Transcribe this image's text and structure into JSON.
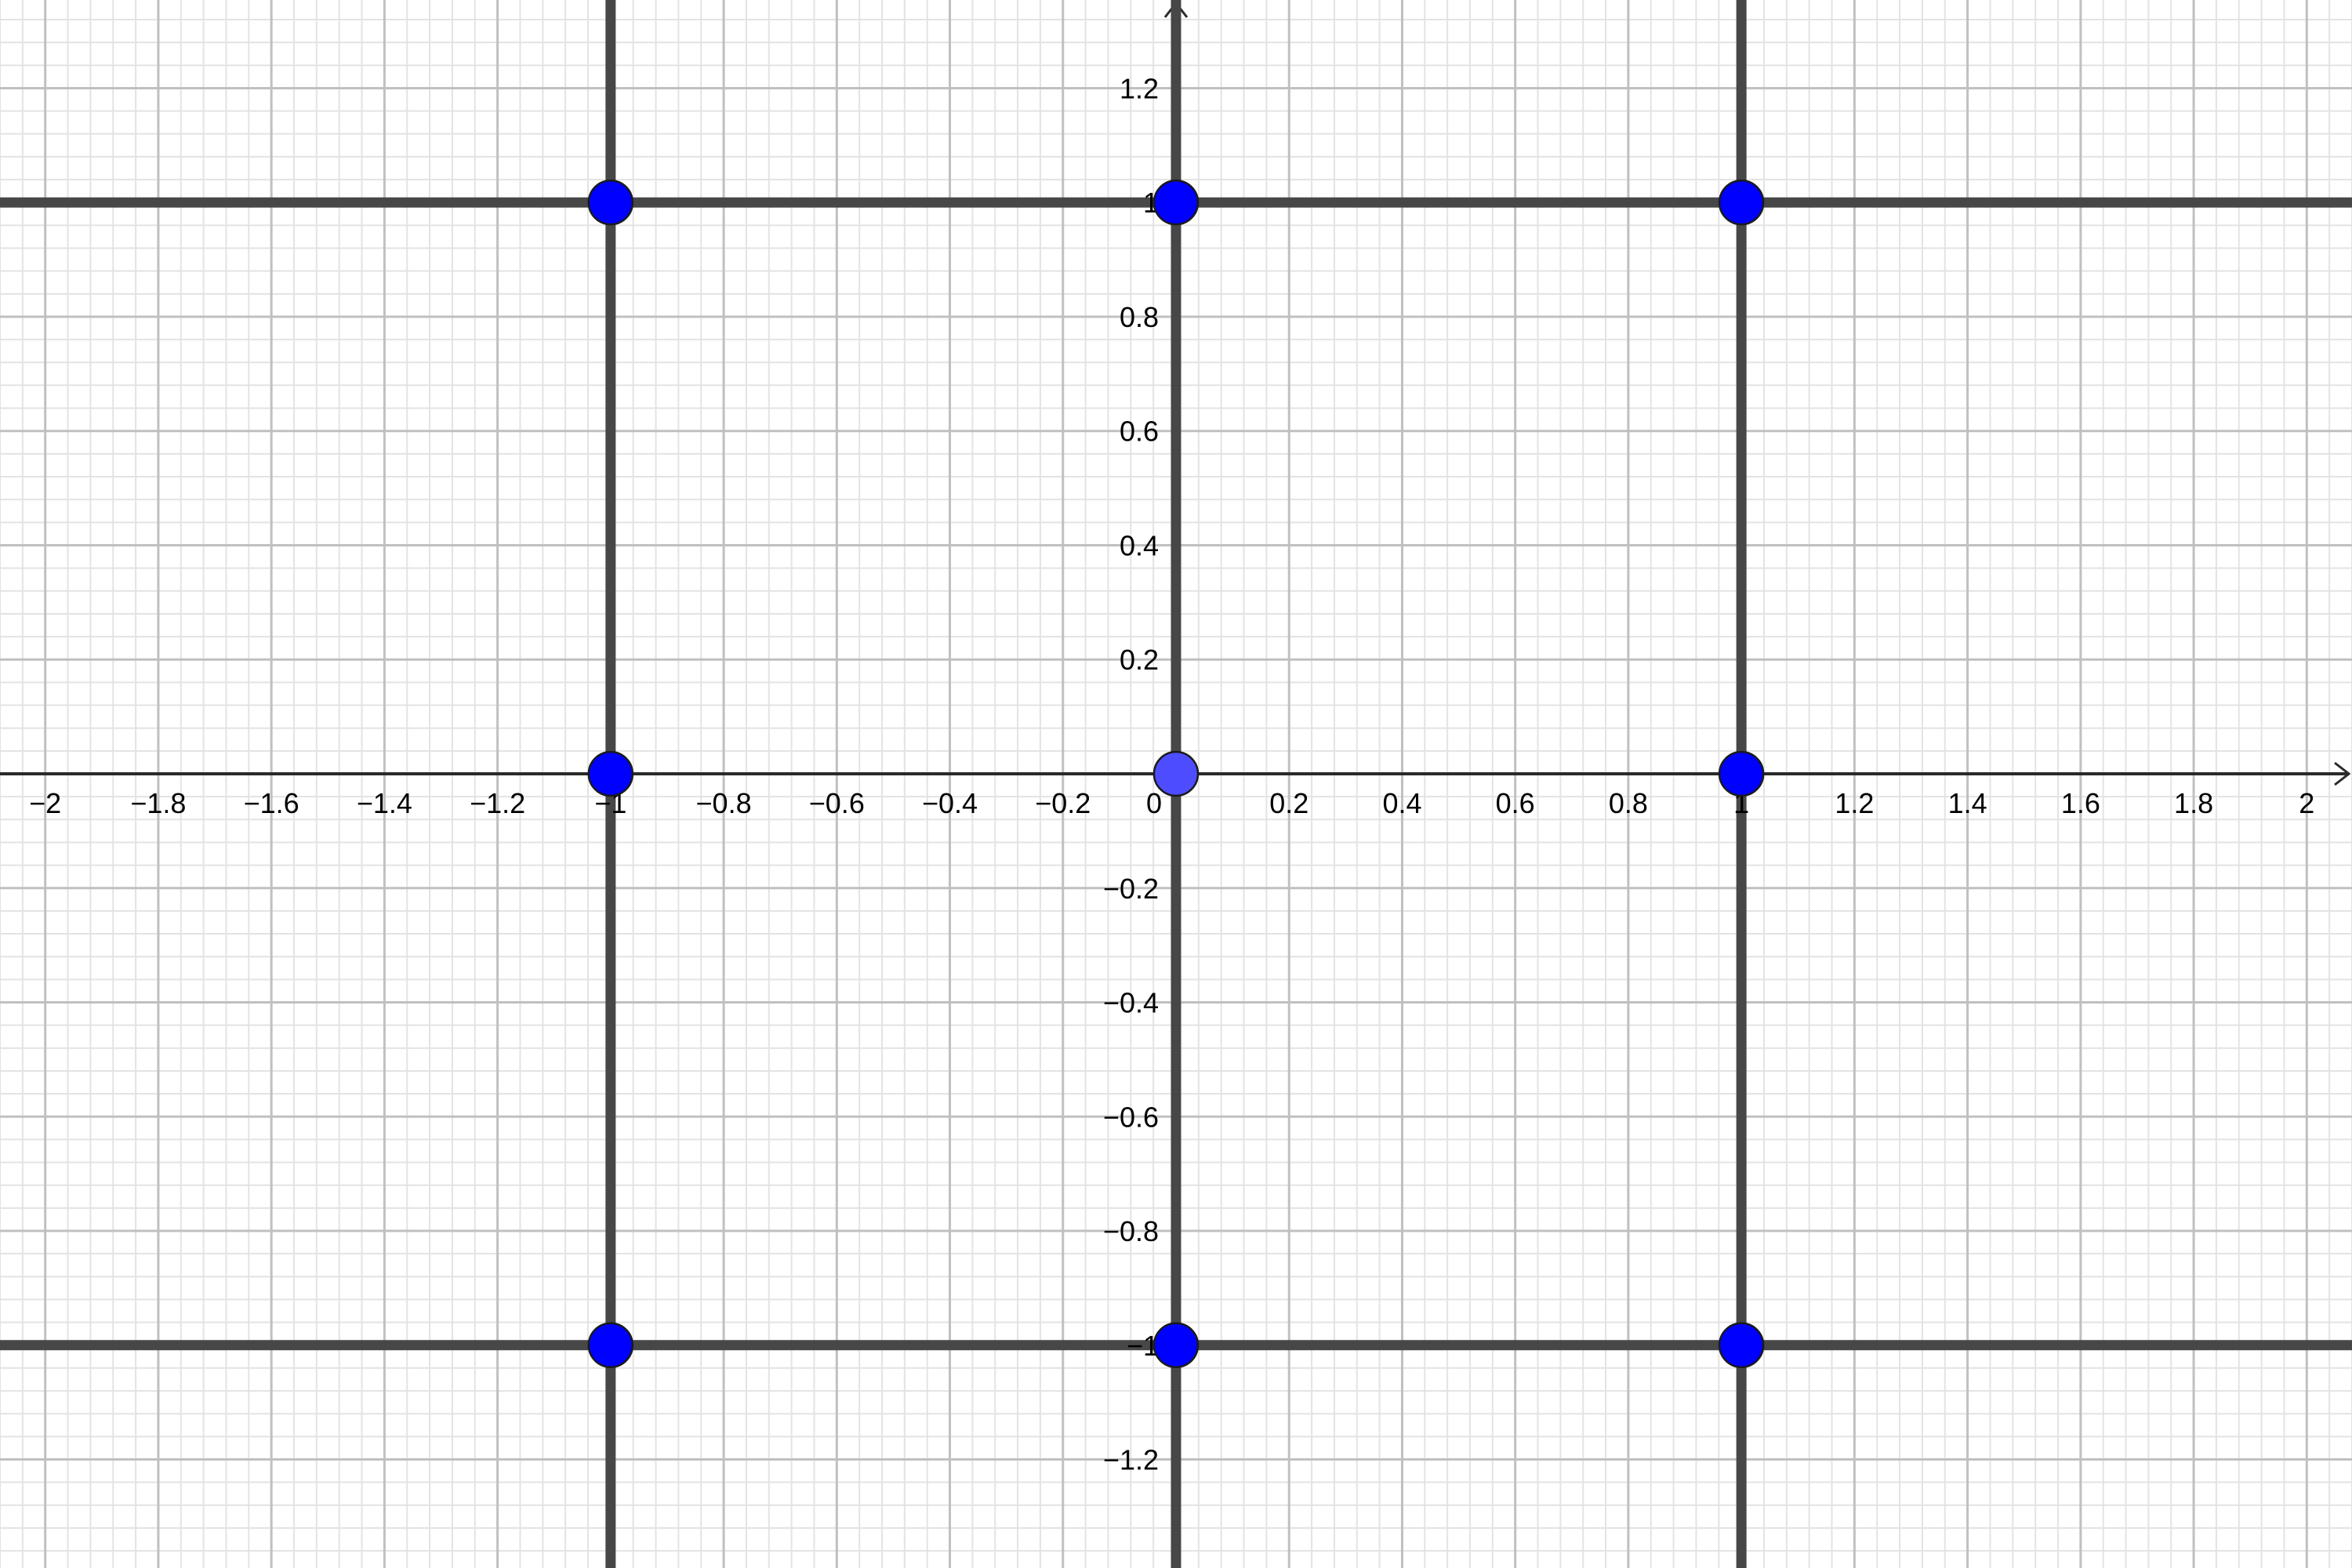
{
  "chart_data": {
    "type": "scatter",
    "title": "",
    "xlabel": "",
    "ylabel": "",
    "xlim": [
      -2.08,
      2.08
    ],
    "ylim": [
      -1.39,
      1.39
    ],
    "grid": true,
    "x_ticks": [
      {
        "value": -2,
        "label": "−2"
      },
      {
        "value": -1.8,
        "label": "−1.8"
      },
      {
        "value": -1.6,
        "label": "−1.6"
      },
      {
        "value": -1.4,
        "label": "−1.4"
      },
      {
        "value": -1.2,
        "label": "−1.2"
      },
      {
        "value": -1,
        "label": "−1"
      },
      {
        "value": -0.8,
        "label": "−0.8"
      },
      {
        "value": -0.6,
        "label": "−0.6"
      },
      {
        "value": -0.4,
        "label": "−0.4"
      },
      {
        "value": -0.2,
        "label": "−0.2"
      },
      {
        "value": 0,
        "label": "0"
      },
      {
        "value": 0.2,
        "label": "0.2"
      },
      {
        "value": 0.4,
        "label": "0.4"
      },
      {
        "value": 0.6,
        "label": "0.6"
      },
      {
        "value": 0.8,
        "label": "0.8"
      },
      {
        "value": 1,
        "label": "1"
      },
      {
        "value": 1.2,
        "label": "1.2"
      },
      {
        "value": 1.4,
        "label": "1.4"
      },
      {
        "value": 1.6,
        "label": "1.6"
      },
      {
        "value": 1.8,
        "label": "1.8"
      },
      {
        "value": 2,
        "label": "2"
      }
    ],
    "y_ticks": [
      {
        "value": 1.2,
        "label": "1.2"
      },
      {
        "value": 1,
        "label": "1"
      },
      {
        "value": 0.8,
        "label": "0.8"
      },
      {
        "value": 0.6,
        "label": "0.6"
      },
      {
        "value": 0.4,
        "label": "0.4"
      },
      {
        "value": 0.2,
        "label": "0.2"
      },
      {
        "value": -0.2,
        "label": "−0.2"
      },
      {
        "value": -0.4,
        "label": "−0.4"
      },
      {
        "value": -0.6,
        "label": "−0.6"
      },
      {
        "value": -0.8,
        "label": "−0.8"
      },
      {
        "value": -1,
        "label": "−1"
      },
      {
        "value": -1.2,
        "label": "−1.2"
      }
    ],
    "lines": [
      {
        "orientation": "vertical",
        "x": -1
      },
      {
        "orientation": "vertical",
        "x": 0
      },
      {
        "orientation": "vertical",
        "x": 1
      },
      {
        "orientation": "horizontal",
        "y": 1
      },
      {
        "orientation": "horizontal",
        "y": -1
      }
    ],
    "points": [
      {
        "x": -1,
        "y": 1,
        "color": "#0000ff"
      },
      {
        "x": 0,
        "y": 1,
        "color": "#0000ff"
      },
      {
        "x": 1,
        "y": 1,
        "color": "#0000ff"
      },
      {
        "x": -1,
        "y": 0,
        "color": "#0000ff"
      },
      {
        "x": 0,
        "y": 0,
        "color": "#4d4dff"
      },
      {
        "x": 1,
        "y": 0,
        "color": "#0000ff"
      },
      {
        "x": -1,
        "y": -1,
        "color": "#0000ff"
      },
      {
        "x": 0,
        "y": -1,
        "color": "#0000ff"
      },
      {
        "x": 1,
        "y": -1,
        "color": "#0000ff"
      }
    ]
  }
}
